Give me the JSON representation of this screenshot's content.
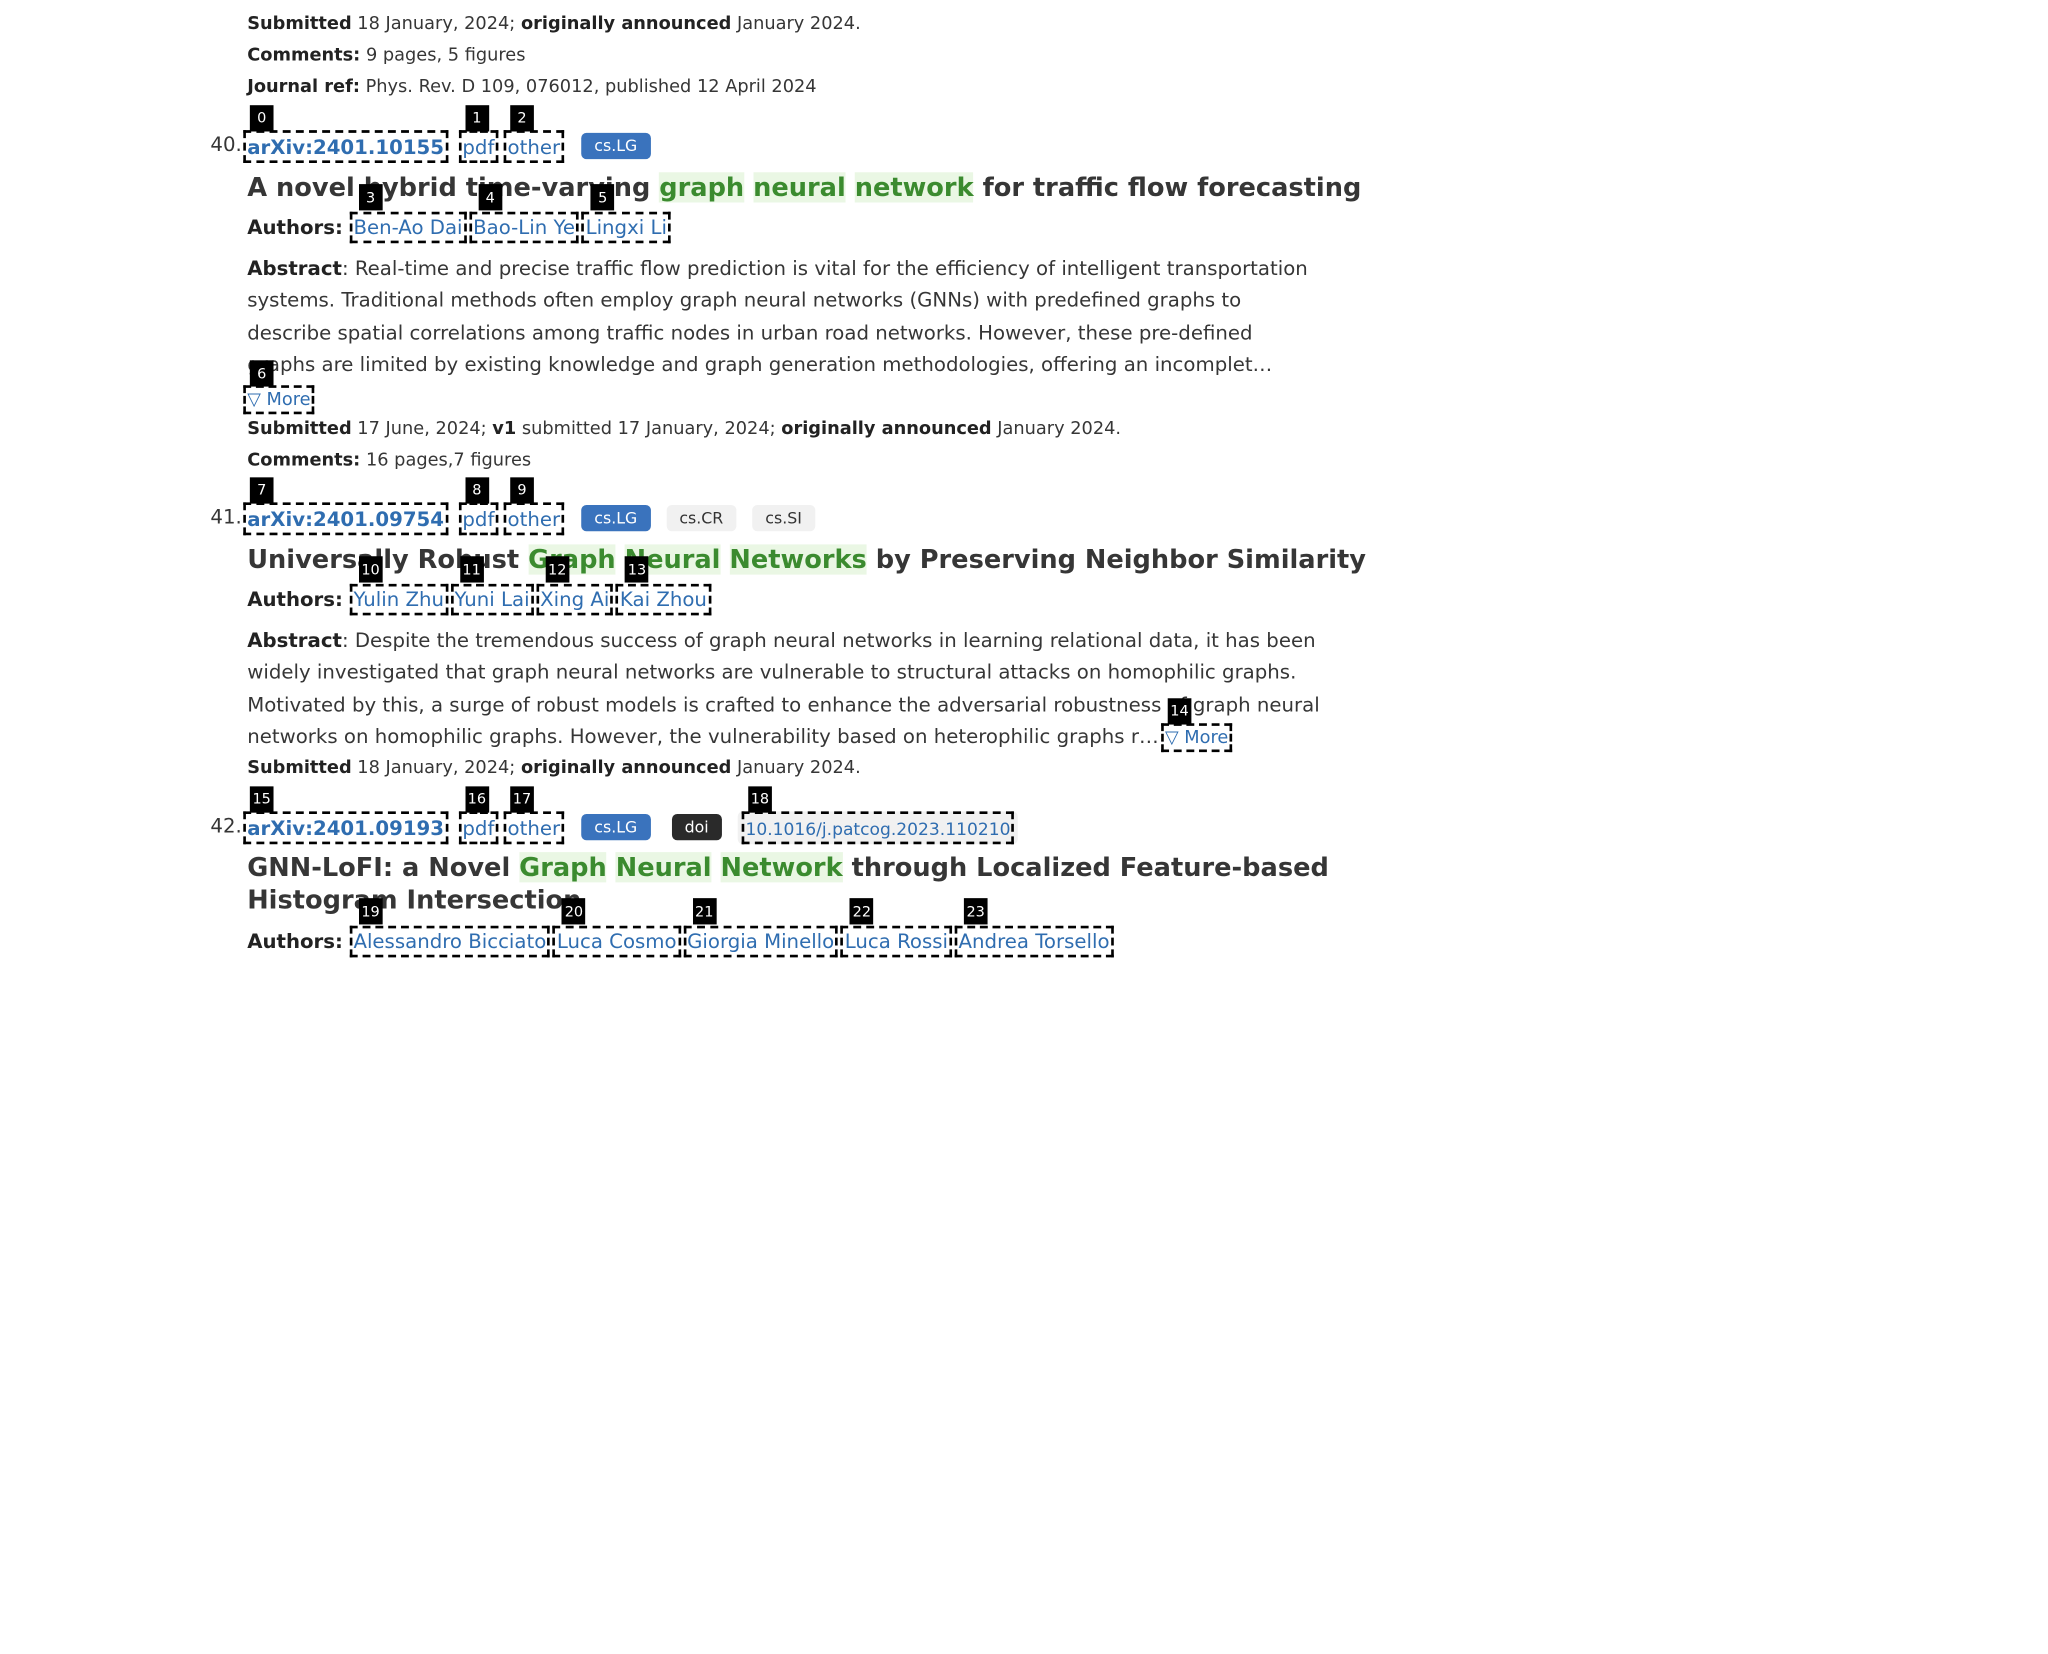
{
  "top": {
    "submitted_label": "Submitted",
    "submitted_date": "18 January, 2024;",
    "announced_label": "originally announced",
    "announced_date": "January 2024.",
    "comments_label": "Comments:",
    "comments_value": "9 pages, 5 figures",
    "journal_label": "Journal ref:",
    "journal_value": "Phys. Rev. D 109, 076012, published 12 April 2024"
  },
  "entries": [
    {
      "number": "40.",
      "arxiv_id": "arXiv:2401.10155",
      "pdf": "pdf",
      "other": "other",
      "tags": [
        "cs.LG"
      ],
      "title_before": "A novel hybrid time-varying",
      "title_hl": [
        "graph",
        "neural",
        "network"
      ],
      "title_after": "for traffic flow forecasting",
      "authors_label": "Authors:",
      "authors": [
        "Ben-Ao Dai",
        "Bao-Lin Ye",
        "Lingxi Li"
      ],
      "abstract_label": "Abstract",
      "abstract_text": ": Real-time and precise traffic flow prediction is vital for the efficiency of intelligent transportation systems. Traditional methods often employ graph neural networks (GNNs) with predefined graphs to describe spatial correlations among traffic nodes in urban road networks. However, these pre-defined graphs are limited by existing knowledge and graph generation methodologies, offering an incomplet…",
      "more": "▽ More",
      "submitted_label": "Submitted",
      "submitted_date": "17 June, 2024;",
      "v1_label": "v1",
      "v1_text": "submitted 17 January, 2024;",
      "announced_label": "originally announced",
      "announced_date": "January 2024.",
      "comments_label": "Comments:",
      "comments_value": "16 pages,7 figures"
    },
    {
      "number": "41.",
      "arxiv_id": "arXiv:2401.09754",
      "pdf": "pdf",
      "other": "other",
      "tags": [
        "cs.LG",
        "cs.CR",
        "cs.SI"
      ],
      "title_before": "Universally Robust",
      "title_hl": [
        "Graph",
        "Neural",
        "Networks"
      ],
      "title_after": "by Preserving Neighbor Similarity",
      "authors_label": "Authors:",
      "authors": [
        "Yulin Zhu",
        "Yuni Lai",
        "Xing Ai",
        "Kai Zhou"
      ],
      "abstract_label": "Abstract",
      "abstract_text": ": Despite the tremendous success of graph neural networks in learning relational data, it has been widely investigated that graph neural networks are vulnerable to structural attacks on homophilic graphs. Motivated by this, a surge of robust models is crafted to enhance the adversarial robustness of graph neural networks on homophilic graphs. However, the vulnerability based on heterophilic graphs r…",
      "more": "▽ More",
      "submitted_label": "Submitted",
      "submitted_date": "18 January, 2024;",
      "announced_label": "originally announced",
      "announced_date": "January 2024."
    },
    {
      "number": "42.",
      "arxiv_id": "arXiv:2401.09193",
      "pdf": "pdf",
      "other": "other",
      "tags": [
        "cs.LG"
      ],
      "doi_label": "doi",
      "doi_value": "10.1016/j.patcog.2023.110210",
      "title_before": "GNN-LoFI: a Novel",
      "title_hl": [
        "Graph",
        "Neural",
        "Network"
      ],
      "title_after": "through Localized Feature-based",
      "title_line2": "Histogram Intersection",
      "authors_label": "Authors:",
      "authors": [
        "Alessandro Bicciato",
        "Luca Cosmo",
        "Giorgia Minello",
        "Luca Rossi",
        "Andrea Torsello"
      ]
    }
  ],
  "markers": [
    "0",
    "1",
    "2",
    "3",
    "4",
    "5",
    "6",
    "7",
    "8",
    "9",
    "10",
    "11",
    "12",
    "13",
    "14",
    "15",
    "16",
    "17",
    "18",
    "19",
    "20",
    "21",
    "22",
    "23"
  ]
}
